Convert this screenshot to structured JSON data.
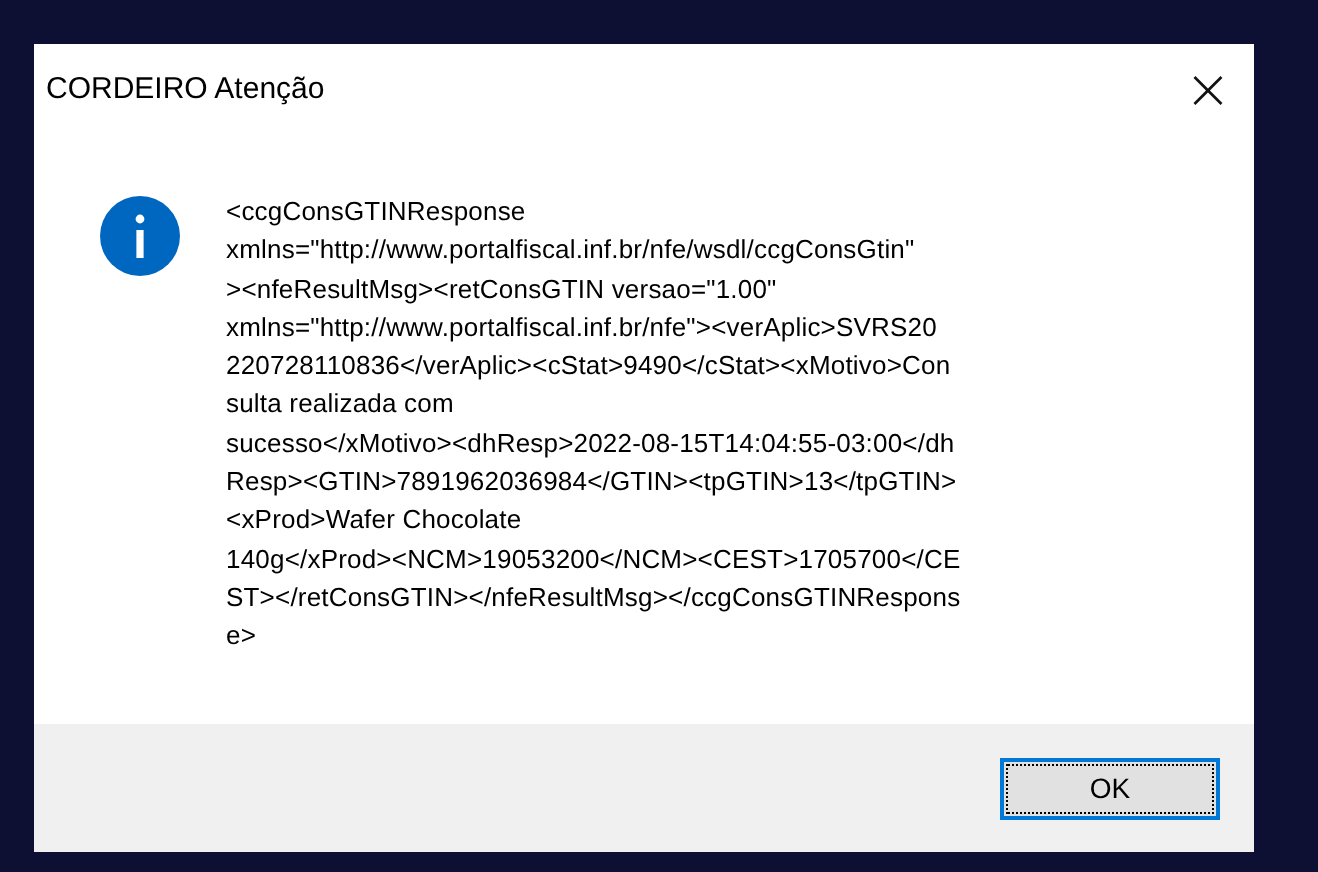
{
  "window": {
    "title": "CORDEIRO Atenção",
    "close": "×"
  },
  "message": {
    "kind": "info",
    "lines": [
      "<ccgConsGTINResponse",
      "xmlns=\"http://www.portalfiscal.inf.br/nfe/wsdl/ccgConsGtin\"",
      "><nfeResultMsg><retConsGTIN versao=\"1.00\"",
      "xmlns=\"http://www.portalfiscal.inf.br/nfe\"><verAplic>SVRS20",
      "220728110836</verAplic><cStat>9490</cStat><xMotivo>Con",
      "sulta realizada com",
      "sucesso</xMotivo><dhResp>2022-08-15T14:04:55-03:00</dh",
      "Resp><GTIN>7891962036984</GTIN><tpGTIN>13</tpGTIN>",
      "<xProd>Wafer Chocolate",
      "140g</xProd><NCM>19053200</NCM><CEST>1705700</CE",
      "ST></retConsGTIN></nfeResultMsg></ccgConsGTINRespons",
      "e>"
    ]
  },
  "buttons": [
    {
      "label": "OK",
      "focused": true
    }
  ]
}
